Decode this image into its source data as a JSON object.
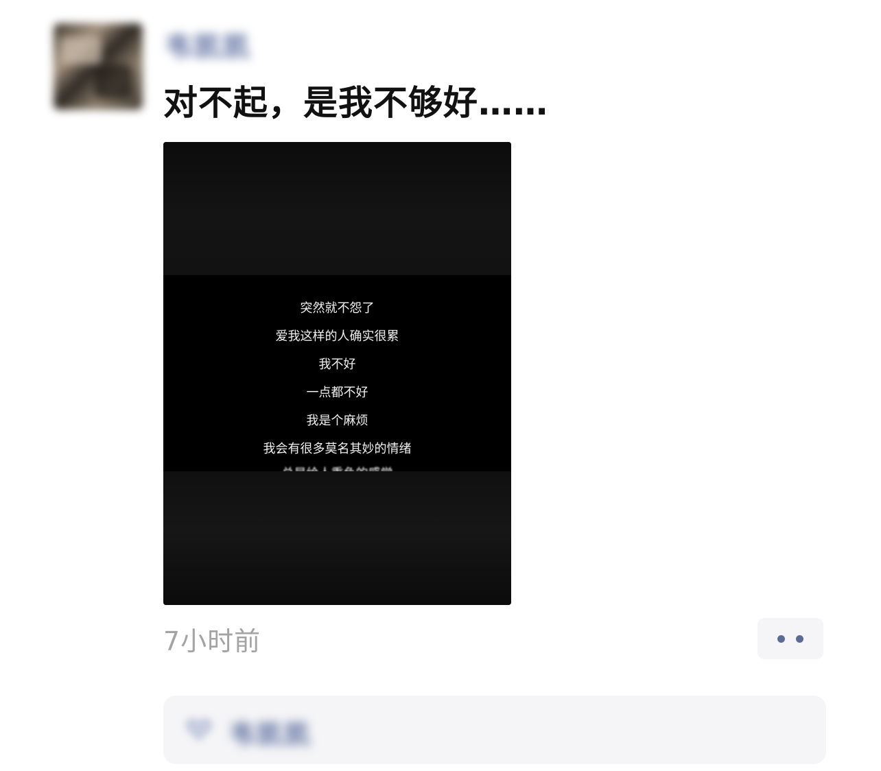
{
  "post": {
    "author": {
      "name": "韦凯凯"
    },
    "text": "对不起，是我不够好……",
    "media": {
      "lyrics": [
        "突然就不怨了",
        "爱我这样的人确实很累",
        "我不好",
        "一点都不好",
        "我是个麻烦",
        "我会有很多莫名其妙的情绪",
        "总是给人重负的感觉"
      ]
    },
    "timestamp": "7小时前",
    "more_button_icon": "more-dots-icon"
  },
  "likes": {
    "icon": "heart-icon",
    "names": "韦凯凯"
  },
  "colors": {
    "nickname": "#5a6c9e",
    "timestamp": "#a3a3a3",
    "panel_bg": "#f5f5f7"
  }
}
